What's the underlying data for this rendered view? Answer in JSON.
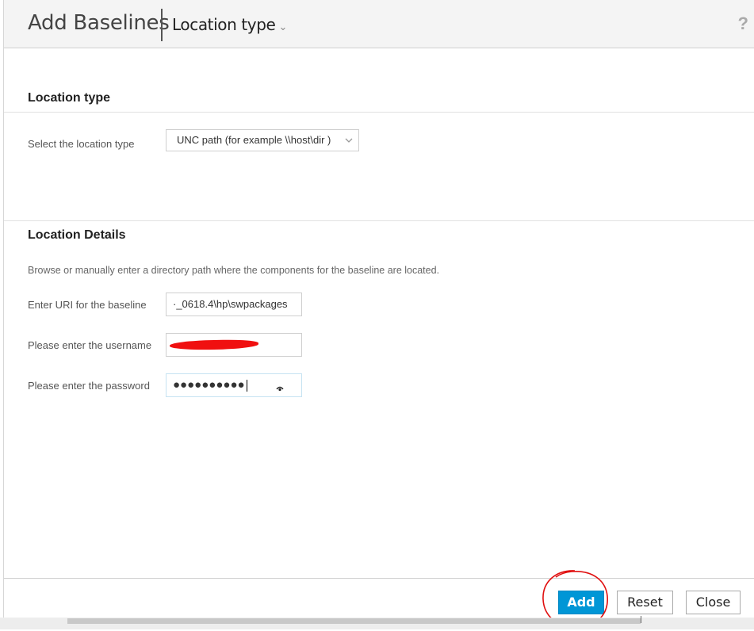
{
  "header": {
    "title": "Add Baselines",
    "view_label": "Location type",
    "view_chevron": "⌄",
    "help": "?"
  },
  "location_type": {
    "section_title": "Location type",
    "field_label": "Select the location type",
    "selected_value": "UNC path (for example \\\\host\\dir )",
    "options": [
      "UNC path (for example \\\\host\\dir )"
    ]
  },
  "location_details": {
    "section_title": "Location Details",
    "description": "Browse or manually enter a directory path where the components for the baseline are located.",
    "uri_label": "Enter URI for the baseline",
    "uri_value": "·_0618.4\\hp\\swpackages",
    "username_label": "Please enter the username",
    "username_value": "",
    "password_label": "Please enter the password",
    "password_value": "●●●●●●●●●●"
  },
  "footer": {
    "add_label": "Add",
    "reset_label": "Reset",
    "close_label": "Close"
  },
  "colors": {
    "accent": "#0096d6",
    "annotation": "#e01010",
    "redaction": "#f01010"
  },
  "icons": {
    "view_chevron": "chevron-down-icon",
    "select_chevron": "chevron-down-icon",
    "password_toggle": "eye-icon",
    "help": "help-icon"
  }
}
